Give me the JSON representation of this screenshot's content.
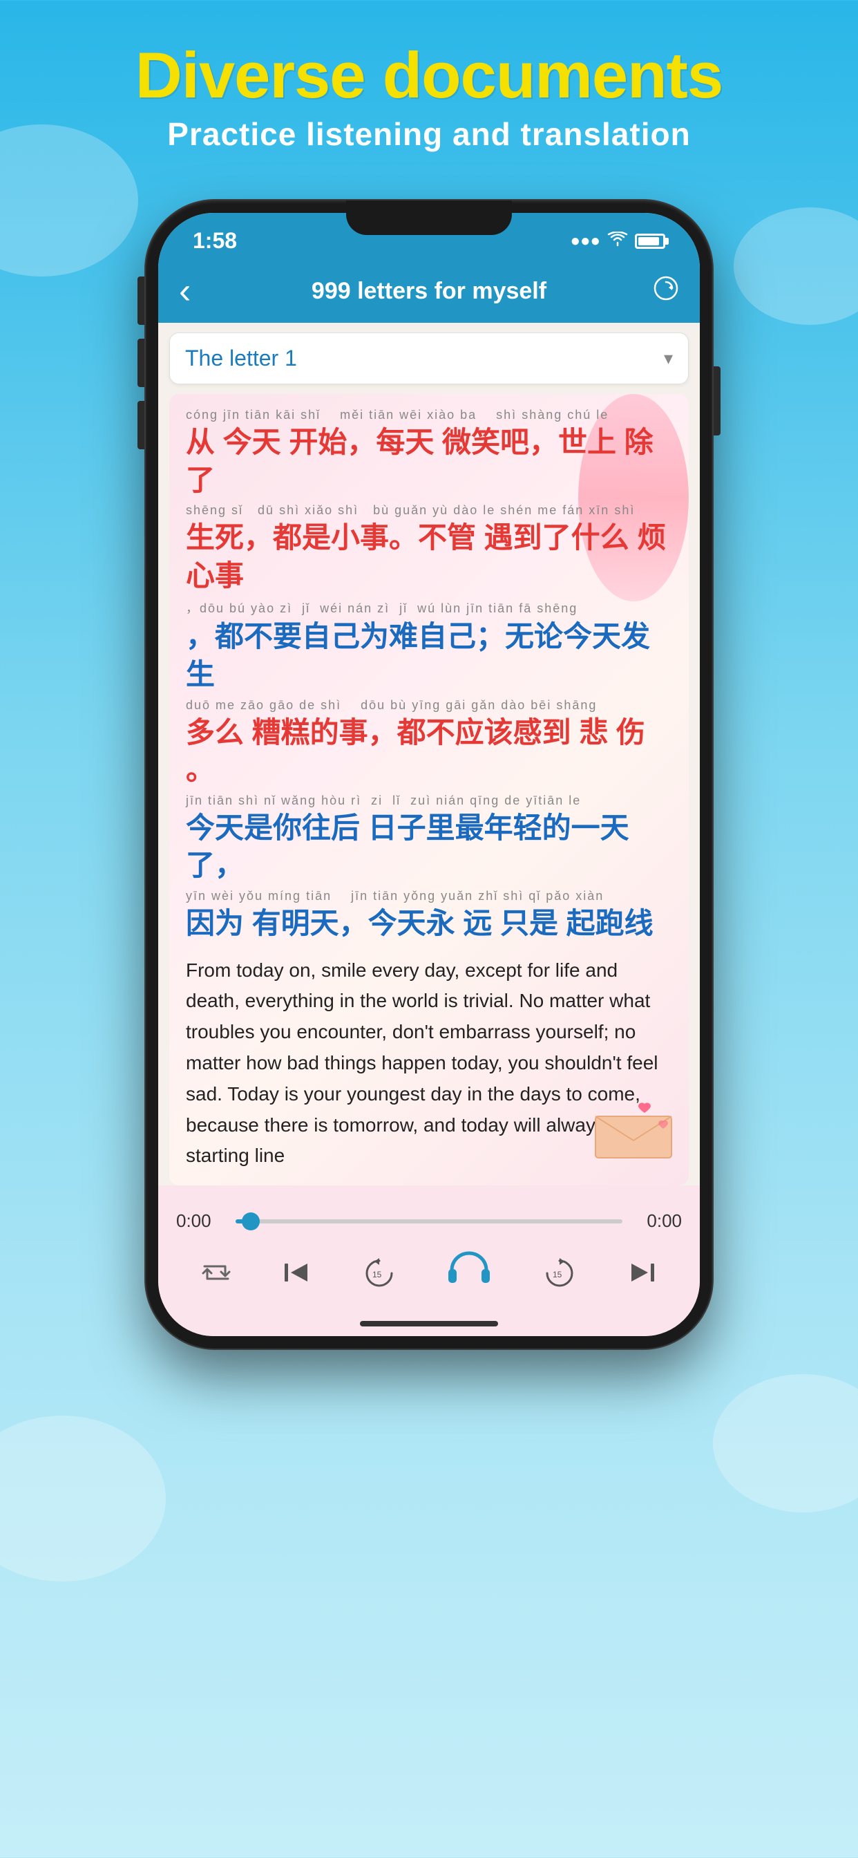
{
  "background": {
    "color_top": "#29b6e8",
    "color_bottom": "#c5eef8"
  },
  "header": {
    "title": "Diverse documents",
    "subtitle": "Practice listening and translation",
    "title_color": "#f5e000",
    "subtitle_color": "#ffffff"
  },
  "phone": {
    "status_bar": {
      "time": "1:58",
      "wifi": true,
      "battery": "80"
    },
    "nav_bar": {
      "back_label": "‹",
      "title": "999 letters for myself",
      "icon_right": "↻"
    },
    "selector": {
      "label": "The letter 1",
      "arrow": "▾"
    },
    "content": {
      "lines": [
        {
          "pinyin": "cóng jīn tiān kāi shǐ   měi tiān wēi xiào ba   shì shàng chú le",
          "hanzi": "从 今天 开始，每天 微笑吧，世上 除了",
          "color": "red"
        },
        {
          "pinyin": "shēng sǐ   dū shì xiǎo shì   bù guǎn yù dào le shén me fán xīn shì",
          "hanzi": "生死，都是小事。不管 遇到了什么 烦心事",
          "color": "red"
        },
        {
          "pinyin": "，dōu bú yào zì  jǐ  wéi nán zì  jǐ  wú lùn jīn tiān fā shēng",
          "hanzi": "，都不要自己为难自己；无论今天发生",
          "color": "blue"
        },
        {
          "pinyin": "duō me zāo gāo de shì   dōu bù yīng gāi gǎn dào bēi shāng",
          "hanzi": "多么 糟糕的事，都不应该感到 悲伤。",
          "color": "red"
        },
        {
          "pinyin": "jīn tiān shì nǐ wǎng hòu rì  zi  lǐ  zuì nián qīng de yītiān le",
          "hanzi": "今天是你往后 日子里最年轻的一天了，",
          "color": "blue"
        },
        {
          "pinyin": "yīn wèi yǒu míng tiān   jīn tiān yǒng yuǎn zhǐ shì qǐ pǎo xiàn",
          "hanzi": "因为 有明天，今天永 远 只是 起跑线",
          "color": "blue"
        }
      ],
      "translation": "From today on, smile every day, except for life and death, everything in the world is trivial. No matter what troubles you encounter, don't embarrass yourself; no matter how bad things happen today, you shouldn't feel sad. Today is your youngest day in the days to come, because there is tomorrow, and today will always be the starting line"
    },
    "audio_player": {
      "current_time": "0:00",
      "total_time": "0:00",
      "progress_percent": 4,
      "controls": {
        "repeat": "↺",
        "skip_back": "⏮",
        "rewind": "↩",
        "play": "▶",
        "forward": "↪",
        "skip_forward": "⏭"
      }
    }
  }
}
